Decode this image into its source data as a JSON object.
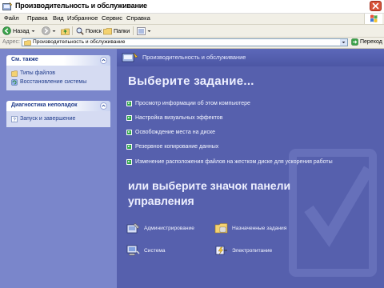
{
  "window": {
    "title": "Производительность и обслуживание"
  },
  "menu": {
    "items": [
      "Файл",
      "Правка",
      "Вид",
      "Избранное",
      "Сервис",
      "Справка"
    ]
  },
  "toolbar": {
    "back": "Назад",
    "search": "Поиск",
    "folders": "Папки"
  },
  "addressbar": {
    "label": "Адрес:",
    "value": "Производительность и обслуживание",
    "go": "Переход"
  },
  "taskpane": {
    "see_also": {
      "header": "См. также",
      "links": [
        "Типы файлов",
        "Восстановление системы"
      ]
    },
    "troubleshooting": {
      "header": "Диагностика неполадок",
      "links": [
        "Запуск и завершение"
      ]
    }
  },
  "main": {
    "section_title": "Производительность и обслуживание",
    "pick_task": "Выберите задание...",
    "tasks": [
      "Просмотр информации об этом компьютере",
      "Настройка визуальных эффектов",
      "Освобождение места на диске",
      "Резервное копирование данных",
      "Изменение расположения файлов на жестком диске для ускорения работы"
    ],
    "pick_icon": "или выберите значок панели управления",
    "control_panel_icons": [
      "Администрирование",
      "Назначенные задания",
      "Система",
      "Электропитание"
    ]
  },
  "colors": {
    "taskpane_bg": "#7a86cb",
    "main_bg": "#5660ad",
    "task_bullet": "#2fa64a",
    "link_text": "#1e3a8a"
  }
}
